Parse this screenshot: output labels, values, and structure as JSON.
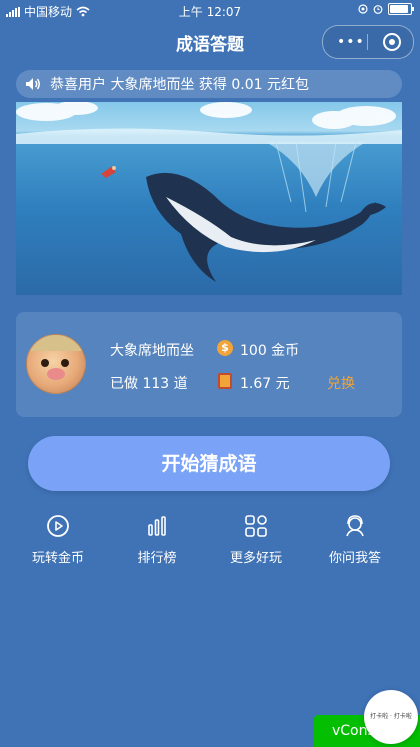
{
  "status_bar": {
    "carrier": "中国移动",
    "time": "上午 12:07"
  },
  "nav": {
    "title": "成语答题"
  },
  "notice": {
    "text": "恭喜用户 大象席地而坐 获得 0.01 元红包"
  },
  "profile": {
    "name": "大象席地而坐",
    "coins": "100 金币",
    "done": "已做 113 道",
    "cash": "1.67 元",
    "exchange_label": "兑换",
    "coin_symbol": "$"
  },
  "start_button": {
    "label": "开始猜成语"
  },
  "menu": [
    {
      "label": "玩转金币",
      "icon": "play-circle-icon"
    },
    {
      "label": "排行榜",
      "icon": "bar-chart-icon"
    },
    {
      "label": "更多好玩",
      "icon": "grid-icon"
    },
    {
      "label": "你问我答",
      "icon": "support-agent-icon"
    }
  ],
  "vconsole": {
    "label": "vConsole"
  },
  "float_bubble": {
    "text": "打卡啦 · 打卡啦"
  },
  "colors": {
    "background": "#3f73b6",
    "button": "#7aa3f7",
    "accent": "#f0a43a",
    "vconsole": "#04be02"
  }
}
